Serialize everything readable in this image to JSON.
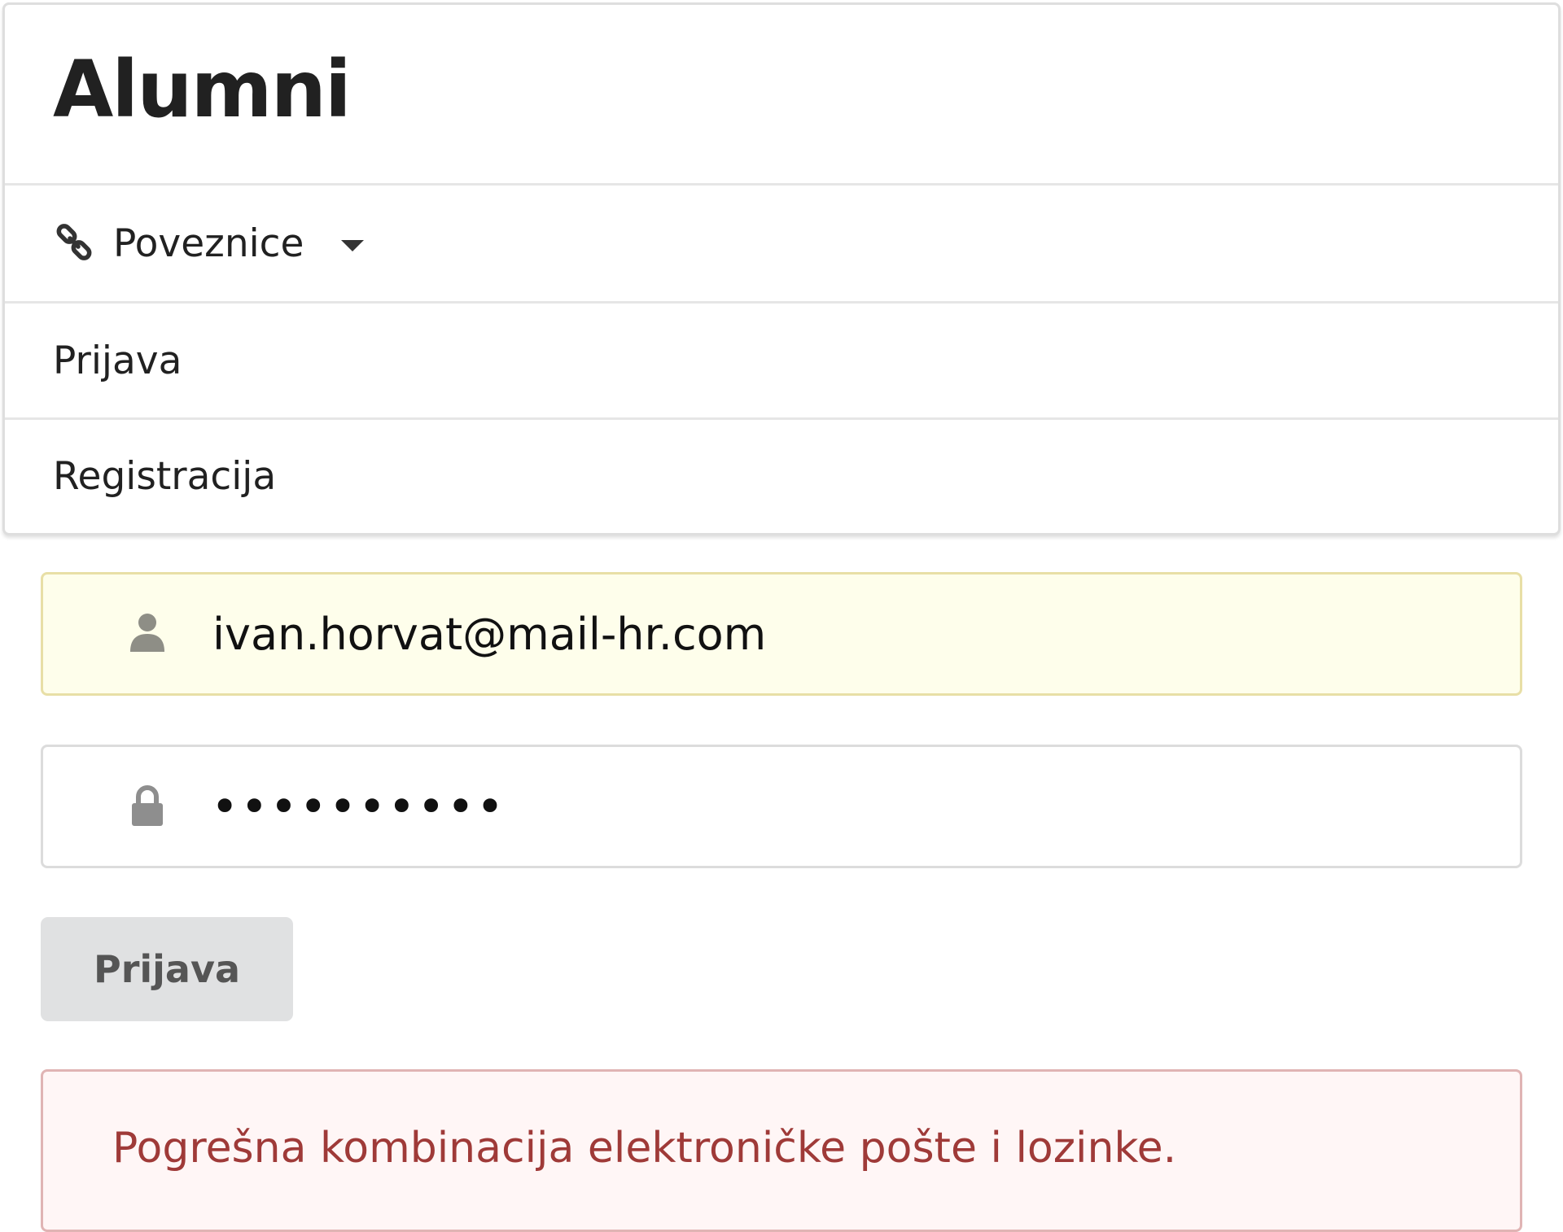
{
  "menu": {
    "brand": "Alumni",
    "links_label": "Poveznice",
    "login_label": "Prijava",
    "register_label": "Registracija"
  },
  "form": {
    "email_value": "ivan.horvat@mail-hr.com",
    "password_value": "••••••••••",
    "submit_label": "Prijava"
  },
  "error": {
    "message": "Pogrešna kombinacija elektroničke pošte i lozinke."
  },
  "colors": {
    "autofill_bg": "#fefeeb",
    "button_bg": "#e0e1e2",
    "error_bg": "#fff6f6",
    "error_text": "#9f3a38"
  },
  "icons": {
    "links": "link-icon",
    "links_dropdown": "caret-down-icon",
    "email": "user-icon",
    "password": "lock-icon"
  }
}
